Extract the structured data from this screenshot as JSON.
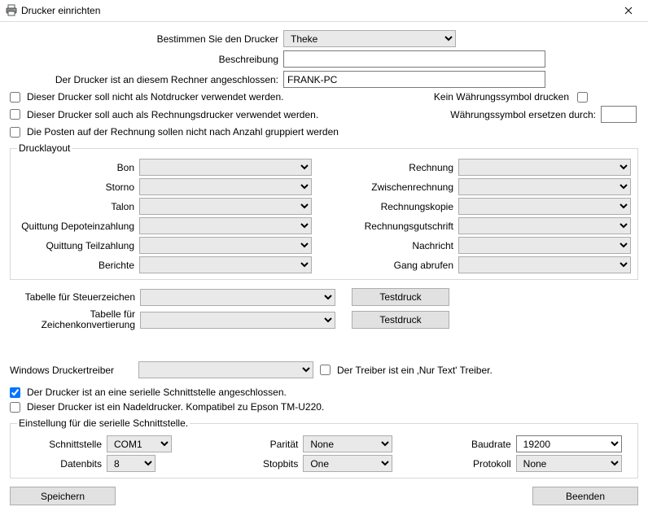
{
  "window": {
    "title": "Drucker einrichten",
    "icon": "printer-icon"
  },
  "header": {
    "chooseLabel": "Bestimmen Sie den Drucker",
    "chooseValue": "Theke",
    "descLabel": "Beschreibung",
    "descValue": "",
    "hostLabel": "Der Drucker ist an diesem Rechner angeschlossen:",
    "hostValue": "FRANK-PC"
  },
  "checks": {
    "notEmergency": "Dieser Drucker soll nicht als Notdrucker verwendet werden.",
    "alsoInvoice": "Dieser Drucker soll auch als Rechnungsdrucker verwendet werden.",
    "noGroupByQty": "Die Posten auf der Rechnung sollen nicht nach Anzahl gruppiert werden"
  },
  "currency": {
    "noSymbolLabel": "Kein Währungssymbol drucken",
    "replaceLabel": "Währungssymbol ersetzen durch:",
    "replaceValue": ""
  },
  "layout": {
    "legend": "Drucklayout",
    "left": {
      "bon": "Bon",
      "storno": "Storno",
      "talon": "Talon",
      "qDepot": "Quittung Depoteinzahlung",
      "qTeil": "Quittung Teilzahlung",
      "berichte": "Berichte"
    },
    "right": {
      "rechnung": "Rechnung",
      "zwRechnung": "Zwischenrechnung",
      "rKopie": "Rechnungskopie",
      "rGutschrift": "Rechnungsgutschrift",
      "nachricht": "Nachricht",
      "gang": "Gang abrufen"
    }
  },
  "tax": {
    "ctrlLabel": "Tabelle für Steuerzeichen",
    "convLabel": "Tabelle für Zeichenkonvertierung",
    "testPrint": "Testdruck"
  },
  "driver": {
    "label": "Windows Druckertreiber",
    "onlyTextLabel": "Der Treiber ist ein ‚Nur Text' Treiber."
  },
  "serialChecks": {
    "isSerial": "Der Drucker ist an eine serielle Schnittstelle angeschlossen.",
    "isDotMatrix": "Dieser Drucker ist ein Nadeldrucker. Kompatibel zu Epson TM-U220."
  },
  "serial": {
    "legend": "Einstellung für die serielle Schnittstelle.",
    "portLabel": "Schnittstelle",
    "portValue": "COM1",
    "dataBitsLabel": "Datenbits",
    "dataBitsValue": "8",
    "parityLabel": "Parität",
    "parityValue": "None",
    "stopBitsLabel": "Stopbits",
    "stopBitsValue": "One",
    "baudLabel": "Baudrate",
    "baudValue": "19200",
    "protocolLabel": "Protokoll",
    "protocolValue": "None"
  },
  "buttons": {
    "save": "Speichern",
    "close": "Beenden"
  }
}
